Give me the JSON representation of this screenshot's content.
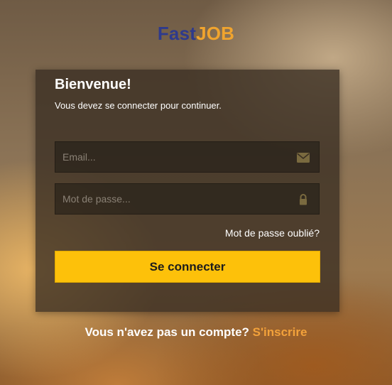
{
  "brand": {
    "part1": "Fast",
    "part2": "JOB",
    "part1_color": "#2e3a8c",
    "part2_color": "#f0a42e"
  },
  "card": {
    "title": "Bienvenue!",
    "subtitle": "Vous devez se connecter pour continuer.",
    "email": {
      "placeholder": "Email...",
      "value": "",
      "icon": "envelope-icon"
    },
    "password": {
      "placeholder": "Mot de passe...",
      "value": "",
      "icon": "lock-icon"
    },
    "forgot_label": "Mot de passe oublié?",
    "submit_label": "Se connecter"
  },
  "footer": {
    "question": "Vous n'avez pas un compte?",
    "signup_label": "S'inscrire"
  },
  "colors": {
    "accent": "#fdc10a",
    "link": "#f3a23b",
    "icon": "#7a6a3f"
  }
}
